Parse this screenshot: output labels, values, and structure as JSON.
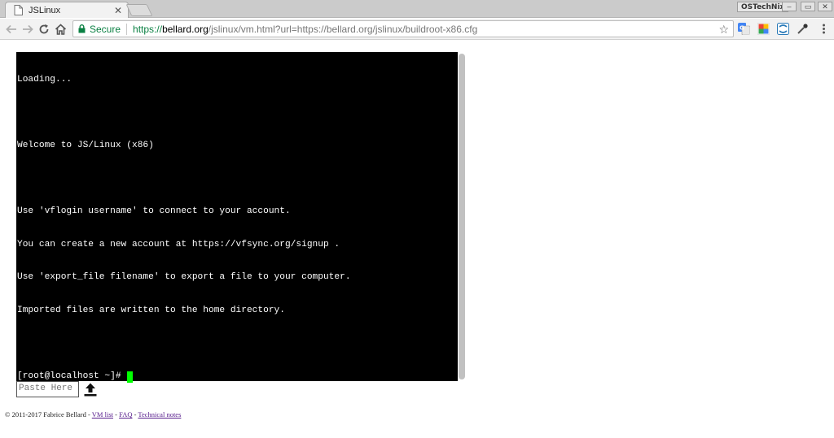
{
  "browser": {
    "tab": {
      "title": "JSLinux",
      "close_glyph": "✕"
    },
    "brand_label": "OSTechNix",
    "window_controls": [
      "–",
      "▭",
      "✕"
    ],
    "toolbar": {
      "back_icon": "arrow-left-icon",
      "forward_icon": "arrow-right-icon",
      "reload_icon": "reload-icon",
      "home_icon": "home-icon"
    },
    "omnibox": {
      "security_label": "Secure",
      "url_scheme": "https://",
      "url_host": "bellard.org",
      "url_rest": "/jslinux/vm.html?url=https://bellard.org/jslinux/buildroot-x86.cfg",
      "star_glyph": "☆"
    },
    "extensions": [
      "translate-icon",
      "google-icon",
      "screenshot-icon",
      "eyedropper-icon",
      "menu-icon"
    ]
  },
  "terminal": {
    "lines": [
      "Loading...",
      "",
      "Welcome to JS/Linux (x86)",
      "",
      "Use 'vflogin username' to connect to your account.",
      "You can create a new account at https://vfsync.org/signup .",
      "Use 'export_file filename' to export a file to your computer.",
      "Imported files are written to the home directory.",
      ""
    ],
    "prompt": "[root@localhost ~]#",
    "background": "#000000",
    "foreground": "#ffffff",
    "cursor_color": "#00ff00"
  },
  "paste_area": {
    "placeholder": "Paste Here"
  },
  "footer": {
    "copyright": "© 2011-2017 Fabrice Bellard - ",
    "links": [
      {
        "label": "VM list"
      },
      {
        "label": "FAQ"
      },
      {
        "label": "Technical notes"
      }
    ],
    "separator": " - "
  }
}
